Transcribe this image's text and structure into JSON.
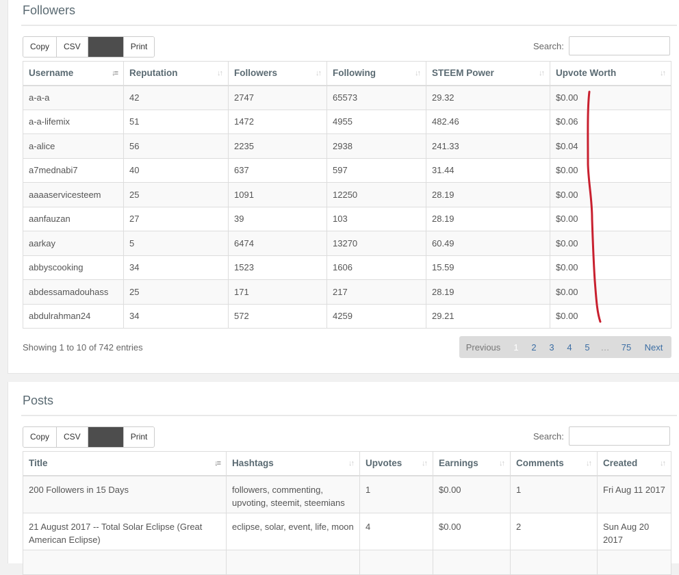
{
  "followers": {
    "title": "Followers",
    "buttons": [
      "Copy",
      "CSV",
      "",
      "Print"
    ],
    "search_label": "Search:",
    "columns": [
      "Username",
      "Reputation",
      "Followers",
      "Following",
      "STEEM Power",
      "Upvote Worth"
    ],
    "rows": [
      [
        "a-a-a",
        "42",
        "2747",
        "65573",
        "29.32",
        "$0.00"
      ],
      [
        "a-a-lifemix",
        "51",
        "1472",
        "4955",
        "482.46",
        "$0.06"
      ],
      [
        "a-alice",
        "56",
        "2235",
        "2938",
        "241.33",
        "$0.04"
      ],
      [
        "a7mednabi7",
        "40",
        "637",
        "597",
        "31.44",
        "$0.00"
      ],
      [
        "aaaaservicesteem",
        "25",
        "1091",
        "12250",
        "28.19",
        "$0.00"
      ],
      [
        "aanfauzan",
        "27",
        "39",
        "103",
        "28.19",
        "$0.00"
      ],
      [
        "aarkay",
        "5",
        "6474",
        "13270",
        "60.49",
        "$0.00"
      ],
      [
        "abbyscooking",
        "34",
        "1523",
        "1606",
        "15.59",
        "$0.00"
      ],
      [
        "abdessamadouhass",
        "25",
        "171",
        "217",
        "28.19",
        "$0.00"
      ],
      [
        "abdulrahman24",
        "34",
        "572",
        "4259",
        "29.21",
        "$0.00"
      ]
    ],
    "info": "Showing 1 to 10 of 742 entries",
    "pagination": {
      "previous": "Previous",
      "current": "1",
      "pages": [
        "2",
        "3",
        "4",
        "5"
      ],
      "ellipsis": "…",
      "last": "75",
      "next": "Next"
    }
  },
  "posts": {
    "title": "Posts",
    "buttons": [
      "Copy",
      "CSV",
      "",
      "Print"
    ],
    "search_label": "Search:",
    "columns": [
      "Title",
      "Hashtags",
      "Upvotes",
      "Earnings",
      "Comments",
      "Created"
    ],
    "rows": [
      [
        "200 Followers in 15 Days",
        "followers, commenting, upvoting, steemit, steemians",
        "1",
        "$0.00",
        "1",
        "Fri Aug 11 2017"
      ],
      [
        "21 August 2017 -- Total Solar Eclipse (Great American Eclipse)",
        "eclipse, solar, event, life, moon",
        "4",
        "$0.00",
        "2",
        "Sun Aug 20 2017"
      ]
    ]
  },
  "colors": {
    "annotation": "#c8202f",
    "link": "#3c6ea4",
    "dark_button": "#4d4d4d"
  }
}
